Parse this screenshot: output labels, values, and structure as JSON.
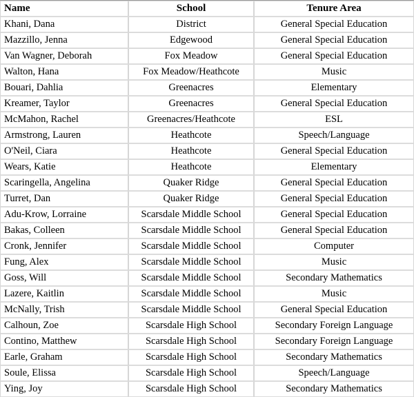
{
  "table": {
    "columns": [
      {
        "key": "name",
        "label": "Name",
        "align": "left"
      },
      {
        "key": "school",
        "label": "School",
        "align": "center"
      },
      {
        "key": "tenure",
        "label": "Tenure Area",
        "align": "center"
      }
    ],
    "rows": [
      {
        "name": "Khani, Dana",
        "school": "District",
        "tenure": "General Special Education"
      },
      {
        "name": "Mazzillo, Jenna",
        "school": "Edgewood",
        "tenure": "General Special Education"
      },
      {
        "name": "Van Wagner, Deborah",
        "school": "Fox Meadow",
        "tenure": "General Special Education"
      },
      {
        "name": "Walton, Hana",
        "school": "Fox Meadow/Heathcote",
        "tenure": "Music"
      },
      {
        "name": "Bouari, Dahlia",
        "school": "Greenacres",
        "tenure": "Elementary"
      },
      {
        "name": "Kreamer, Taylor",
        "school": "Greenacres",
        "tenure": "General Special Education"
      },
      {
        "name": "McMahon, Rachel",
        "school": "Greenacres/Heathcote",
        "tenure": "ESL"
      },
      {
        "name": "Armstrong, Lauren",
        "school": "Heathcote",
        "tenure": "Speech/Language"
      },
      {
        "name": "O'Neil, Ciara",
        "school": "Heathcote",
        "tenure": "General Special Education"
      },
      {
        "name": "Wears, Katie",
        "school": "Heathcote",
        "tenure": "Elementary"
      },
      {
        "name": "Scaringella, Angelina",
        "school": "Quaker Ridge",
        "tenure": "General Special Education"
      },
      {
        "name": "Turret, Dan",
        "school": "Quaker Ridge",
        "tenure": "General Special Education"
      },
      {
        "name": "Adu-Krow, Lorraine",
        "school": "Scarsdale Middle School",
        "tenure": "General Special Education"
      },
      {
        "name": "Bakas, Colleen",
        "school": "Scarsdale Middle School",
        "tenure": "General Special Education"
      },
      {
        "name": "Cronk, Jennifer",
        "school": "Scarsdale Middle School",
        "tenure": "Computer"
      },
      {
        "name": "Fung, Alex",
        "school": "Scarsdale Middle School",
        "tenure": "Music"
      },
      {
        "name": "Goss, Will",
        "school": "Scarsdale Middle School",
        "tenure": "Secondary Mathematics"
      },
      {
        "name": "Lazere, Kaitlin",
        "school": "Scarsdale Middle School",
        "tenure": "Music"
      },
      {
        "name": "McNally, Trish",
        "school": "Scarsdale Middle School",
        "tenure": "General Special Education"
      },
      {
        "name": "Calhoun, Zoe",
        "school": "Scarsdale High School",
        "tenure": "Secondary Foreign Language"
      },
      {
        "name": "Contino, Matthew",
        "school": "Scarsdale High School",
        "tenure": "Secondary Foreign Language"
      },
      {
        "name": "Earle, Graham",
        "school": "Scarsdale High School",
        "tenure": "Secondary Mathematics"
      },
      {
        "name": "Soule, Elissa",
        "school": "Scarsdale High School",
        "tenure": "Speech/Language"
      },
      {
        "name": "Ying, Joy",
        "school": "Scarsdale High School",
        "tenure": "Secondary Mathematics"
      }
    ]
  },
  "colors": {
    "cell_border": "#d6d6d6",
    "outer_top_border": "#9a9a9a",
    "outer_bottom_border": "#5a5a5a",
    "background": "#ffffff",
    "text": "#000000"
  }
}
